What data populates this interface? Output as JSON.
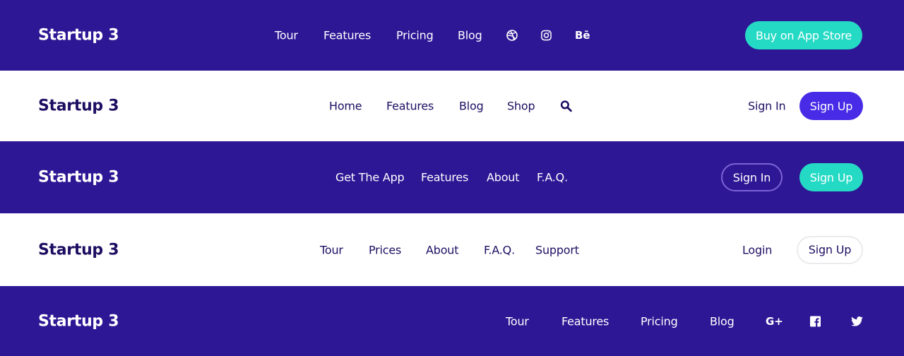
{
  "colors": {
    "dark_bg": "#2e1795",
    "light_bg": "#ffffff",
    "dark_text": "#1e0e62",
    "teal": "#25dac5",
    "purple": "#482be7"
  },
  "headers": [
    {
      "logo": "Startup 3",
      "nav": [
        "Tour",
        "Features",
        "Pricing",
        "Blog"
      ],
      "icons": [
        "dribbble-icon",
        "instagram-icon",
        "behance-icon"
      ],
      "behance_glyph": "Bē",
      "cta": "Buy on App Store"
    },
    {
      "logo": "Startup 3",
      "nav": [
        "Home",
        "Features",
        "Blog",
        "Shop"
      ],
      "icons": [
        "search-icon"
      ],
      "sign_in": "Sign In",
      "sign_up": "Sign Up"
    },
    {
      "logo": "Startup 3",
      "nav": [
        "Get The App",
        "Features",
        "About",
        "F.A.Q."
      ],
      "sign_in": "Sign In",
      "sign_up": "Sign Up"
    },
    {
      "logo": "Startup 3",
      "nav": [
        "Tour",
        "Prices",
        "About",
        "F.A.Q.",
        "Support"
      ],
      "login": "Login",
      "sign_up": "Sign Up"
    },
    {
      "logo": "Startup 3",
      "nav": [
        "Tour",
        "Features",
        "Pricing",
        "Blog"
      ],
      "icons": [
        "google-plus-icon",
        "facebook-icon",
        "twitter-icon"
      ],
      "google_plus_glyph": "G+"
    }
  ]
}
